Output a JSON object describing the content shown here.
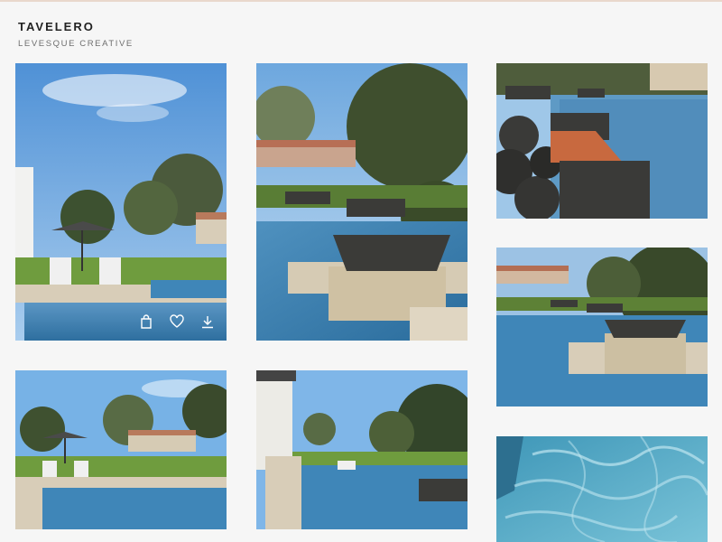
{
  "header": {
    "title": "TAVELERO",
    "subtitle": "LEVESQUE CREATIVE"
  },
  "gallery": {
    "photos": [
      {
        "alt": "Backyard pool with lounge chairs and umbrella"
      },
      {
        "alt": "Pool with fire bowl water features"
      },
      {
        "alt": "Close-up of black stone planter bowl waterfall"
      },
      {
        "alt": "Pool with raised planter bowls and landscaping"
      },
      {
        "alt": "Wide view of pool and lawn with umbrella"
      },
      {
        "alt": "Pool edge view from house"
      },
      {
        "alt": "Close-up of rippling blue pool water"
      }
    ],
    "actions": [
      "add-to-collection-icon",
      "heart-icon",
      "download-icon"
    ]
  },
  "colors": {
    "sky": "#7fb6e8",
    "pool": "#3f86b8",
    "lawn": "#6f9c3e",
    "stone": "#d8cdb8"
  }
}
